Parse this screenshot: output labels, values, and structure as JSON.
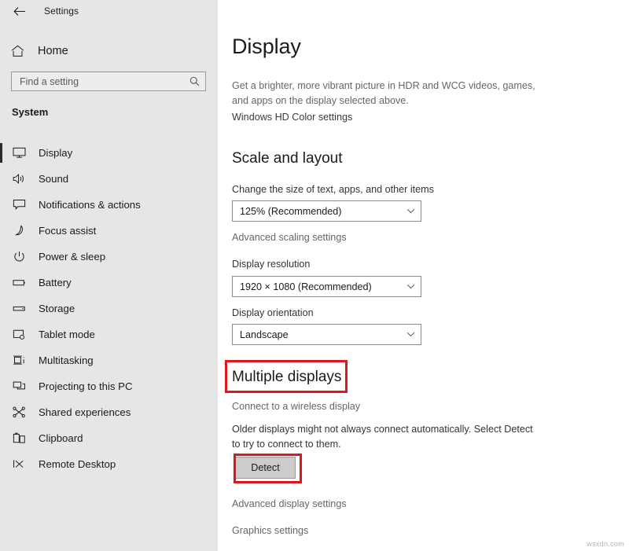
{
  "window": {
    "app_title": "Settings",
    "back_icon": "back-arrow-icon"
  },
  "sidebar": {
    "home": {
      "label": "Home",
      "icon": "home-icon"
    },
    "search": {
      "placeholder": "Find a setting",
      "value": "",
      "icon": "search-icon"
    },
    "group_header": "System",
    "items": [
      {
        "label": "Display",
        "icon": "monitor-icon",
        "selected": true
      },
      {
        "label": "Sound",
        "icon": "speaker-icon",
        "selected": false
      },
      {
        "label": "Notifications & actions",
        "icon": "notification-icon",
        "selected": false
      },
      {
        "label": "Focus assist",
        "icon": "moon-icon",
        "selected": false
      },
      {
        "label": "Power & sleep",
        "icon": "power-icon",
        "selected": false
      },
      {
        "label": "Battery",
        "icon": "battery-icon",
        "selected": false
      },
      {
        "label": "Storage",
        "icon": "storage-icon",
        "selected": false
      },
      {
        "label": "Tablet mode",
        "icon": "tablet-icon",
        "selected": false
      },
      {
        "label": "Multitasking",
        "icon": "multitasking-icon",
        "selected": false
      },
      {
        "label": "Projecting to this PC",
        "icon": "projecting-icon",
        "selected": false
      },
      {
        "label": "Shared experiences",
        "icon": "share-icon",
        "selected": false
      },
      {
        "label": "Clipboard",
        "icon": "clipboard-icon",
        "selected": false
      },
      {
        "label": "Remote Desktop",
        "icon": "remote-desktop-icon",
        "selected": false
      }
    ]
  },
  "main": {
    "page_title": "Display",
    "hdr_description": "Get a brighter, more vibrant picture in HDR and WCG videos, games, and apps on the display selected above.",
    "hdr_link": "Windows HD Color settings",
    "scale_section": {
      "title": "Scale and layout",
      "scale_label": "Change the size of text, apps, and other items",
      "scale_value": "125% (Recommended)",
      "advanced_scaling_link": "Advanced scaling settings",
      "resolution_label": "Display resolution",
      "resolution_value": "1920 × 1080 (Recommended)",
      "orientation_label": "Display orientation",
      "orientation_value": "Landscape"
    },
    "multiple_section": {
      "title": "Multiple displays",
      "wireless_link": "Connect to a wireless display",
      "detect_description": "Older displays might not always connect automatically. Select Detect to try to connect to them.",
      "detect_button": "Detect",
      "advanced_display_link": "Advanced display settings",
      "graphics_link": "Graphics settings"
    }
  },
  "annotations": {
    "color": "#e0161e",
    "highlighted": [
      "Multiple displays",
      "Detect"
    ]
  },
  "watermark": "wsxdn.com"
}
